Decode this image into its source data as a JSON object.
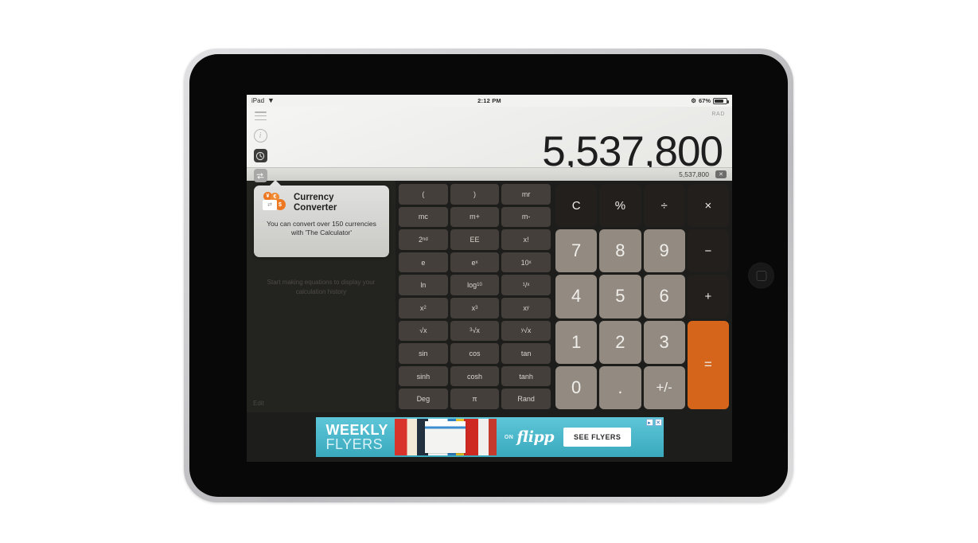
{
  "status_bar": {
    "device_label": "iPad",
    "wifi_icon": "wifi-icon",
    "time": "2:12 PM",
    "bluetooth_icon": "bluetooth-icon",
    "battery_percent": "67%"
  },
  "toolbar": {
    "menu_icon": "hamburger-menu-icon",
    "info_icon": "info-circle-icon",
    "history_icon": "clock-history-icon",
    "converter_icon": "currency-converter-icon"
  },
  "display": {
    "angle_mode": "RAD",
    "main_value": "5,537,800",
    "input_value": "5,537,800",
    "backspace_icon": "backspace-delete-icon"
  },
  "history": {
    "empty_message": "Start making equations to display your calculation history",
    "edit_label": "Edit"
  },
  "popover": {
    "title_line1": "Currency",
    "title_line2": "Converter",
    "body": "You can convert over 150 currencies with 'The Calculator'",
    "icon_symbols": {
      "yen": "¥",
      "euro": "€",
      "dollar": "$",
      "exchange": "⇄"
    }
  },
  "scientific_keys": [
    {
      "id": "paren-open",
      "label": "("
    },
    {
      "id": "paren-close",
      "label": ")"
    },
    {
      "id": "mr",
      "label": "mr"
    },
    {
      "id": "mc",
      "label": "mc"
    },
    {
      "id": "m-plus",
      "label": "m+"
    },
    {
      "id": "m-minus",
      "label": "m-"
    },
    {
      "id": "second",
      "label": "2",
      "sup": "nd"
    },
    {
      "id": "ee",
      "label": "EE"
    },
    {
      "id": "factorial",
      "label": "x!"
    },
    {
      "id": "e",
      "label": "e"
    },
    {
      "id": "e-pow-x",
      "label": "e",
      "sup": "x"
    },
    {
      "id": "ten-pow-x",
      "label": "10",
      "sup": "x"
    },
    {
      "id": "ln",
      "label": "ln"
    },
    {
      "id": "log10",
      "label": "log",
      "sub": "10"
    },
    {
      "id": "reciprocal",
      "label": "¹/",
      "sub": "x"
    },
    {
      "id": "x-squared",
      "label": "x",
      "sup": "2"
    },
    {
      "id": "x-cubed",
      "label": "x",
      "sup": "3"
    },
    {
      "id": "x-pow-y",
      "label": "x",
      "sup": "y"
    },
    {
      "id": "sqrt",
      "label": "√x"
    },
    {
      "id": "cube-root",
      "presup": "3",
      "label": "√x"
    },
    {
      "id": "y-root",
      "presup": "y",
      "label": "√x"
    },
    {
      "id": "sin",
      "label": "sin"
    },
    {
      "id": "cos",
      "label": "cos"
    },
    {
      "id": "tan",
      "label": "tan"
    },
    {
      "id": "sinh",
      "label": "sinh"
    },
    {
      "id": "cosh",
      "label": "cosh"
    },
    {
      "id": "tanh",
      "label": "tanh"
    },
    {
      "id": "deg",
      "label": "Deg"
    },
    {
      "id": "pi",
      "label": "π"
    },
    {
      "id": "rand",
      "label": "Rand"
    }
  ],
  "numeric_keys": [
    {
      "id": "clear",
      "label": "C",
      "style": "dark"
    },
    {
      "id": "percent",
      "label": "%",
      "style": "dark"
    },
    {
      "id": "divide",
      "label": "÷",
      "style": "dark"
    },
    {
      "id": "multiply",
      "label": "×",
      "style": "dark"
    },
    {
      "id": "seven",
      "label": "7",
      "style": "light"
    },
    {
      "id": "eight",
      "label": "8",
      "style": "light"
    },
    {
      "id": "nine",
      "label": "9",
      "style": "light"
    },
    {
      "id": "minus",
      "label": "−",
      "style": "dark"
    },
    {
      "id": "four",
      "label": "4",
      "style": "light"
    },
    {
      "id": "five",
      "label": "5",
      "style": "light"
    },
    {
      "id": "six",
      "label": "6",
      "style": "light"
    },
    {
      "id": "plus",
      "label": "+",
      "style": "dark"
    },
    {
      "id": "one",
      "label": "1",
      "style": "light"
    },
    {
      "id": "two",
      "label": "2",
      "style": "light"
    },
    {
      "id": "three",
      "label": "3",
      "style": "light"
    },
    {
      "id": "equals",
      "label": "=",
      "style": "equals"
    },
    {
      "id": "zero",
      "label": "0",
      "style": "light"
    },
    {
      "id": "decimal",
      "label": ".",
      "style": "light"
    },
    {
      "id": "sign",
      "label": "+/-",
      "style": "light"
    }
  ],
  "ad": {
    "headline_1": "WEEKLY",
    "headline_2": "FLYERS",
    "on_label": "ON",
    "brand": "flipp",
    "cta_label": "SEE FLYERS",
    "adchoices_icon": "adchoices-icon",
    "close_icon": "close-icon"
  },
  "device": {
    "home_button_icon": "home-button-icon"
  },
  "colors": {
    "accent_orange": "#d4651a",
    "key_light": "#938b82",
    "key_dark": "#221f1d",
    "sci_key": "#443f3a",
    "panel_dark": "#232320",
    "ad_teal": "#3aa9bd"
  }
}
